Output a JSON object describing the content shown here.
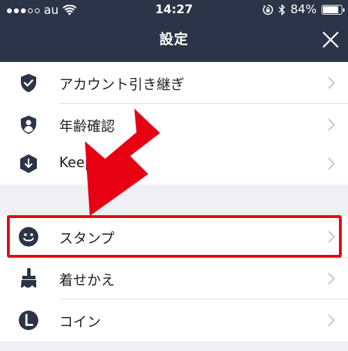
{
  "status_bar": {
    "carrier": "au",
    "time": "14:27",
    "battery": "84%",
    "battery_level": 0.84,
    "signal_bars": 5,
    "signal_active": 3,
    "icons": [
      "wifi-icon",
      "rotation-lock-icon",
      "bluetooth-icon",
      "battery-icon"
    ]
  },
  "nav": {
    "title": "設定",
    "close_icon": "close-icon"
  },
  "sections": [
    {
      "items": [
        {
          "label": "アカウント引き継ぎ",
          "icon": "shield-check-icon"
        },
        {
          "label": "年齢確認",
          "icon": "shield-person-icon"
        },
        {
          "label": "Keep",
          "icon": "keep-download-icon"
        }
      ]
    },
    {
      "items": [
        {
          "label": "スタンプ",
          "icon": "smiley-icon",
          "highlighted": true
        },
        {
          "label": "着せかえ",
          "icon": "paintbrush-icon"
        },
        {
          "label": "コイン",
          "icon": "coin-l-icon"
        }
      ]
    }
  ],
  "annotation": {
    "color": "#e60012",
    "arrow_icon": "red-arrow-icon"
  },
  "colors": {
    "header_bg": "#2c3447",
    "icon": "#2c3447",
    "chevron": "#c7c7cc",
    "section_gap": "#efeff4"
  }
}
